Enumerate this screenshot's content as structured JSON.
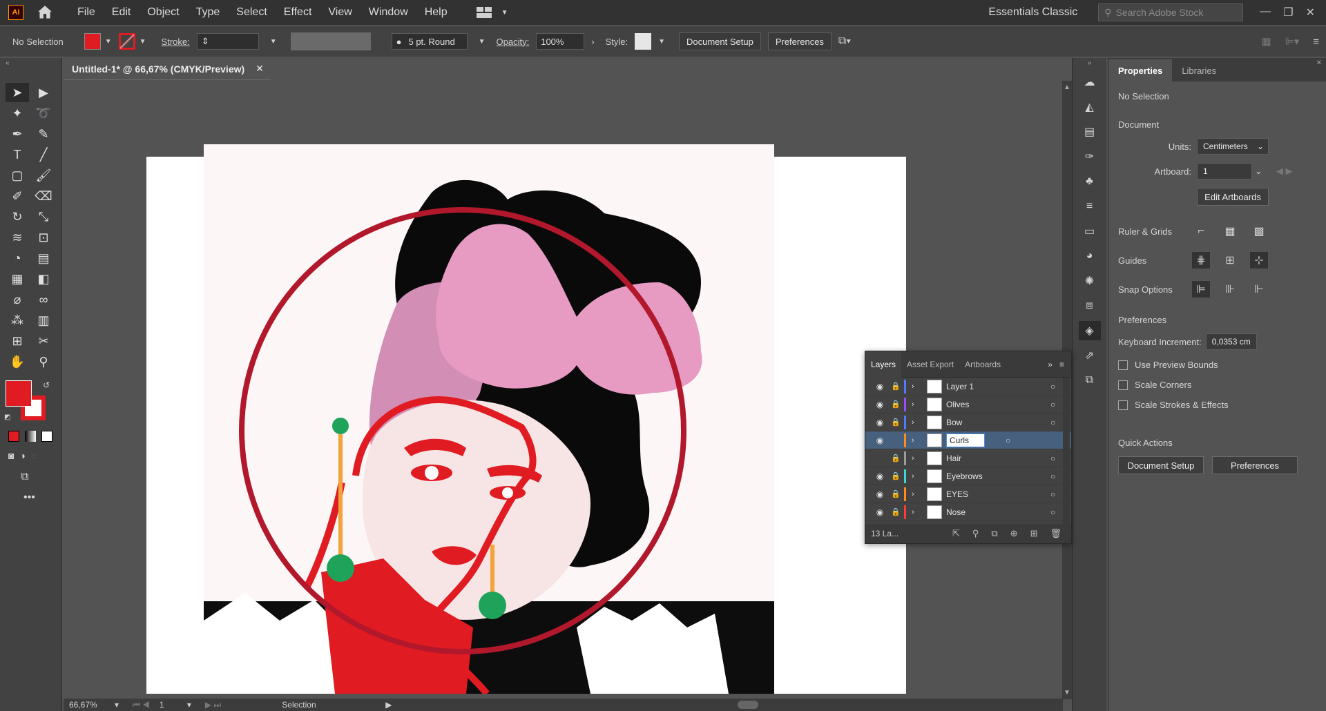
{
  "app": {
    "logo": "Ai"
  },
  "menu": [
    "File",
    "Edit",
    "Object",
    "Type",
    "Select",
    "Effect",
    "View",
    "Window",
    "Help"
  ],
  "workspace": "Essentials Classic",
  "stock_search": {
    "placeholder": "Search Adobe Stock"
  },
  "control_bar": {
    "selection": "No Selection",
    "stroke_label": "Stroke:",
    "brush": "5 pt. Round",
    "opacity_label": "Opacity:",
    "opacity_value": "100%",
    "style_label": "Style:",
    "document_setup": "Document Setup",
    "preferences": "Preferences"
  },
  "document": {
    "tab_title": "Untitled-1* @ 66,67% (CMYK/Preview)"
  },
  "status_bar": {
    "zoom": "66,67%",
    "artboard": "1",
    "tool": "Selection"
  },
  "properties": {
    "tabs": [
      "Properties",
      "Libraries"
    ],
    "selection": "No Selection",
    "document_title": "Document",
    "units_label": "Units:",
    "units_value": "Centimeters",
    "artboard_label": "Artboard:",
    "artboard_value": "1",
    "edit_artboards": "Edit Artboards",
    "ruler_grids": "Ruler & Grids",
    "guides": "Guides",
    "snap_options": "Snap Options",
    "preferences_title": "Preferences",
    "keyboard_increment_label": "Keyboard Increment:",
    "keyboard_increment_value": "0,0353 cm",
    "use_preview_bounds": "Use Preview Bounds",
    "scale_corners": "Scale Corners",
    "scale_strokes": "Scale Strokes & Effects",
    "quick_actions": "Quick Actions",
    "document_setup": "Document Setup",
    "preferences": "Preferences"
  },
  "layers_panel": {
    "tabs": [
      "Layers",
      "Asset Export",
      "Artboards"
    ],
    "layers": [
      {
        "name": "Layer 1",
        "color": "#4f7bff",
        "eye": true,
        "lock": true
      },
      {
        "name": "Olives",
        "color": "#9b4dff",
        "eye": true,
        "lock": true
      },
      {
        "name": "Bow",
        "color": "#4f7bff",
        "eye": true,
        "lock": true
      },
      {
        "name": "Curls",
        "color": "#ff8c1a",
        "eye": true,
        "lock": false
      },
      {
        "name": "Hair",
        "color": "#9b9b9b",
        "eye": false,
        "lock": true
      },
      {
        "name": "Eyebrows",
        "color": "#3dd6d6",
        "eye": true,
        "lock": true
      },
      {
        "name": "EYES",
        "color": "#ff8c1a",
        "eye": true,
        "lock": true
      },
      {
        "name": "Nose",
        "color": "#ff3b3b",
        "eye": true,
        "lock": true
      }
    ],
    "footer": "13 La..."
  },
  "colors": {
    "fill": "#e01b22",
    "bow": "#e79ac2",
    "bow_back": "#d28eb5",
    "circle": "#b2182b",
    "earring": "#1fa35a",
    "earring_stem": "#f2a33a"
  }
}
